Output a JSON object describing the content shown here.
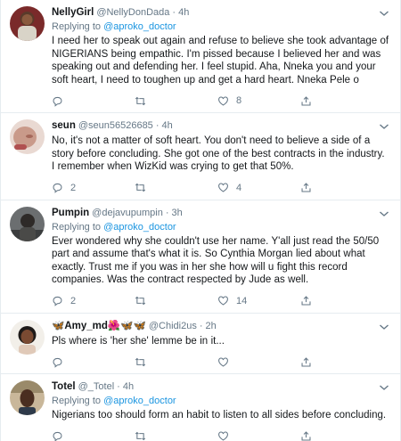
{
  "colors": {
    "link": "#1b95e0",
    "muted": "#657786",
    "text": "#14171a",
    "divider": "#e6ecf0"
  },
  "tweets": [
    {
      "name": "NellyGirl",
      "handle": "@NellyDonDada",
      "dot": "·",
      "time": "4h",
      "replying_prefix": "Replying to",
      "replying_to": "@aproko_doctor",
      "text": "I need her to speak out again and refuse to believe she took advantage of NIGERIANS being empathic. I'm pissed because I believed her and was speaking out and defending her. I feel stupid. Aha, Nneka you and your soft heart, I need to toughen up and get a hard heart. Nneka Pele o",
      "reply_count": "",
      "retweet_count": "",
      "like_count": "8"
    },
    {
      "name": "seun",
      "handle": "@seun56526685",
      "dot": "·",
      "time": "4h",
      "replying_prefix": "",
      "replying_to": "",
      "text": "No, it's not a matter of soft heart. You don't need to believe a side of a story before concluding. She got one of the best contracts in the industry. I remember when WizKid was crying to get that 50%.",
      "reply_count": "2",
      "retweet_count": "",
      "like_count": "4"
    },
    {
      "name": "Pumpin",
      "handle": "@dejavupumpin",
      "dot": "·",
      "time": "3h",
      "replying_prefix": "Replying to",
      "replying_to": "@aproko_doctor",
      "text": "Ever wondered why she couldn't use her name. Y'all just read the 50/50 part and assume that's what it is. So Cynthia Morgan lied about what exactly. Trust me if you was in her she how will u fight this record companies. Was the contract respected by Jude as well.",
      "reply_count": "2",
      "retweet_count": "",
      "like_count": "14"
    },
    {
      "name": "🦋Amy_md🌺🦋🦋",
      "handle": "@Chidi2us",
      "dot": "·",
      "time": "2h",
      "replying_prefix": "",
      "replying_to": "",
      "text": "Pls where is 'her she' lemme be in it...",
      "reply_count": "",
      "retweet_count": "",
      "like_count": ""
    },
    {
      "name": "Totel",
      "handle": "@_Totel",
      "dot": "·",
      "time": "4h",
      "replying_prefix": "Replying to",
      "replying_to": "@aproko_doctor",
      "text": "Nigerians too should form an habit to listen to all sides before concluding.",
      "reply_count": "",
      "retweet_count": "",
      "like_count": ""
    }
  ]
}
